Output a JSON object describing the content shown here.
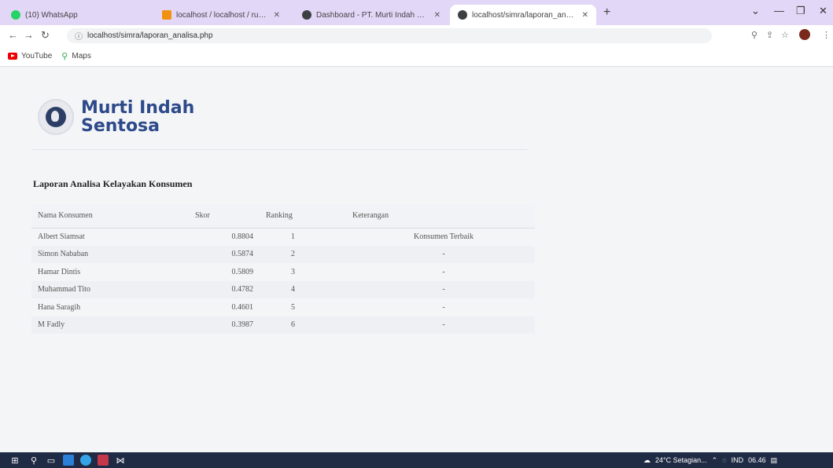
{
  "browser": {
    "tabs": [
      {
        "title": "(10) WhatsApp",
        "favicon_color": "#25d366",
        "active": false
      },
      {
        "title": "localhost / localhost / rumor / pt...",
        "favicon_color": "#f29111",
        "active": false
      },
      {
        "title": "Dashboard - PT. Murti Indah Se...",
        "favicon_color": "#3c4043",
        "active": false
      },
      {
        "title": "localhost/simra/laporan_analisi...",
        "favicon_color": "#3c4043",
        "active": true
      }
    ],
    "new_tab": "+",
    "url": "localhost/simra/laporan_analisa.php",
    "bookmarks": [
      {
        "label": "YouTube",
        "icon": "youtube-icon"
      },
      {
        "label": "Maps",
        "icon": "maps-icon"
      }
    ]
  },
  "brand": {
    "line1": "Murti Indah",
    "line2": "Sentosa",
    "color": "#2d4a8a"
  },
  "report": {
    "title": "Laporan Analisa Kelayakan Konsumen",
    "columns": [
      "Nama Konsumen",
      "Skor",
      "Ranking",
      "Keterangan"
    ],
    "rows": [
      {
        "nama": "Albert Siamsat",
        "skor": "0.8804",
        "ranking": "1",
        "keterangan": "Konsumen Terbaik"
      },
      {
        "nama": "Simon Nababan",
        "skor": "0.5874",
        "ranking": "2",
        "keterangan": "-"
      },
      {
        "nama": "Hamar Dintis",
        "skor": "0.5809",
        "ranking": "3",
        "keterangan": "-"
      },
      {
        "nama": "Muhammad Tito",
        "skor": "0.4782",
        "ranking": "4",
        "keterangan": "-"
      },
      {
        "nama": "Hana Saragih",
        "skor": "0.4601",
        "ranking": "5",
        "keterangan": "-"
      },
      {
        "nama": "M Fadly",
        "skor": "0.3987",
        "ranking": "6",
        "keterangan": "-"
      }
    ]
  },
  "taskbar": {
    "weather": "24°C Setagian...",
    "lang": "IND",
    "time": "06.46"
  }
}
